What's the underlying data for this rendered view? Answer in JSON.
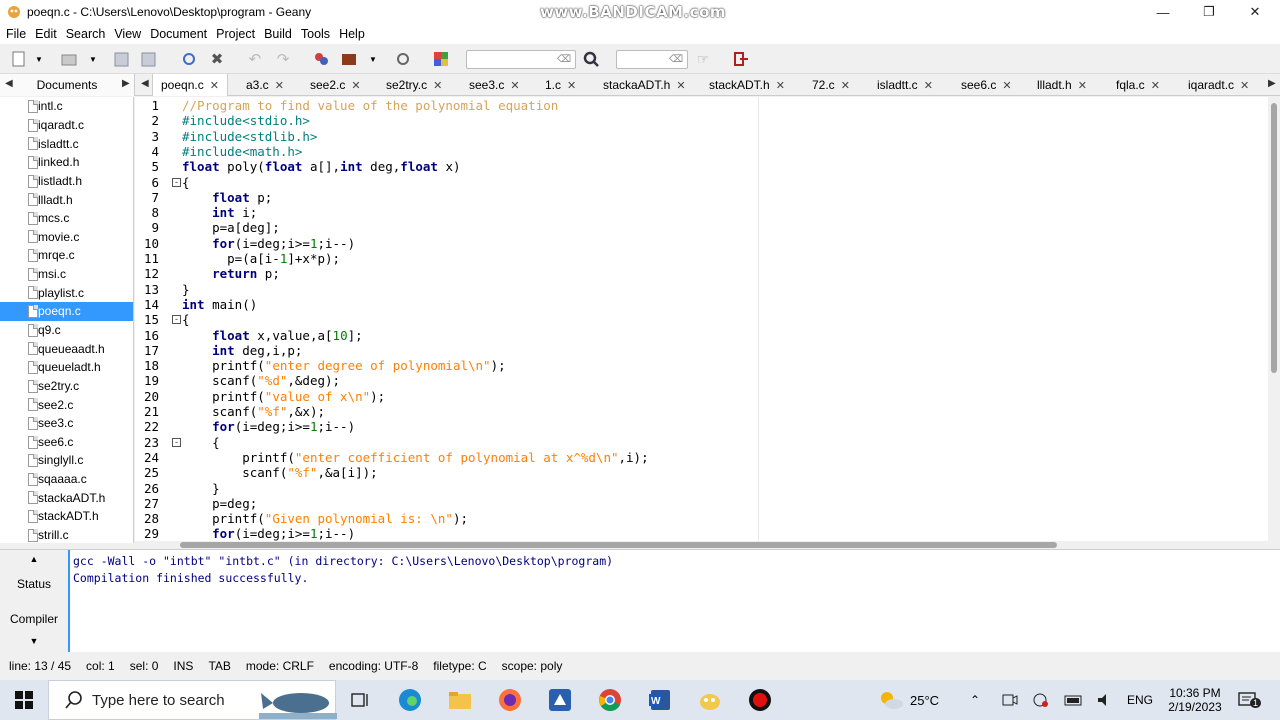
{
  "window": {
    "title": "poeqn.c - C:\\Users\\Lenovo\\Desktop\\program - Geany",
    "watermark": "www.BANDICAM.com"
  },
  "menu": [
    "File",
    "Edit",
    "Search",
    "View",
    "Document",
    "Project",
    "Build",
    "Tools",
    "Help"
  ],
  "toolbar": {
    "search_placeholder": "",
    "goto_placeholder": ""
  },
  "sidebar": {
    "tab_label": "Documents",
    "files": [
      "intl.c",
      "iqaradt.c",
      "isladtt.c",
      "linked.h",
      "listladt.h",
      "llladt.h",
      "mcs.c",
      "movie.c",
      "mrqe.c",
      "msi.c",
      "playlist.c",
      "poeqn.c",
      "q9.c",
      "queueaadt.h",
      "queueladt.h",
      "se2try.c",
      "see2.c",
      "see3.c",
      "see6.c",
      "singlyll.c",
      "sqaaaa.c",
      "stackaADT.h",
      "stackADT.h",
      "strill.c"
    ],
    "selected_index": 11
  },
  "tabs": [
    "poeqn.c",
    "a3.c",
    "see2.c",
    "se2try.c",
    "see3.c",
    "1.c",
    "stackaADT.h",
    "stackADT.h",
    "72.c",
    "isladtt.c",
    "see6.c",
    "llladt.h",
    "fqla.c",
    "iqaradt.c"
  ],
  "editor": {
    "lines": [
      {
        "n": "1",
        "code": "//Program to find value of the polynomial equation"
      },
      {
        "n": "2",
        "code": "#include<stdio.h>"
      },
      {
        "n": "3",
        "code": "#include<stdlib.h>"
      },
      {
        "n": "4",
        "code": "#include<math.h>"
      },
      {
        "n": "5",
        "code": "float poly(float a[],int deg,float x)"
      },
      {
        "n": "6",
        "code": "{"
      },
      {
        "n": "7",
        "code": "    float p;"
      },
      {
        "n": "8",
        "code": "    int i;"
      },
      {
        "n": "9",
        "code": "    p=a[deg];"
      },
      {
        "n": "10",
        "code": "    for(i=deg;i>=1;i--)"
      },
      {
        "n": "11",
        "code": "      p=(a[i-1]+x*p);"
      },
      {
        "n": "12",
        "code": "    return p;"
      },
      {
        "n": "13",
        "code": "}"
      },
      {
        "n": "14",
        "code": "int main()"
      },
      {
        "n": "15",
        "code": "{"
      },
      {
        "n": "16",
        "code": "    float x,value,a[10];"
      },
      {
        "n": "17",
        "code": "    int deg,i,p;"
      },
      {
        "n": "18",
        "code": "    printf(\"enter degree of polynomial\\n\");"
      },
      {
        "n": "19",
        "code": "    scanf(\"%d\",&deg);"
      },
      {
        "n": "20",
        "code": "    printf(\"value of x\\n\");"
      },
      {
        "n": "21",
        "code": "    scanf(\"%f\",&x);"
      },
      {
        "n": "22",
        "code": "    for(i=deg;i>=1;i--)"
      },
      {
        "n": "23",
        "code": "    {"
      },
      {
        "n": "24",
        "code": "        printf(\"enter coefficient of polynomial at x^%d\\n\",i);"
      },
      {
        "n": "25",
        "code": "        scanf(\"%f\",&a[i]);"
      },
      {
        "n": "26",
        "code": "    }"
      },
      {
        "n": "27",
        "code": "    p=deg;"
      },
      {
        "n": "28",
        "code": "    printf(\"Given polynomial is: \\n\");"
      },
      {
        "n": "29",
        "code": "    for(i=deg;i>=1;i--)"
      }
    ]
  },
  "messages": {
    "status_label": "Status",
    "compiler_label": "Compiler",
    "lines": [
      "gcc -Wall -o \"intbt\" \"intbt.c\" (in directory: C:\\Users\\Lenovo\\Desktop\\program)",
      "Compilation finished successfully."
    ]
  },
  "statusbar": {
    "line": "line: 13 / 45",
    "col": "col: 1",
    "sel": "sel: 0",
    "ins": "INS",
    "tab": "TAB",
    "mode": "mode: CRLF",
    "encoding": "encoding: UTF-8",
    "filetype": "filetype: C",
    "scope": "scope: poly"
  },
  "taskbar": {
    "search_placeholder": "Type here to search",
    "temperature": "25°C",
    "language": "ENG",
    "time": "10:36 PM",
    "date": "2/19/2023",
    "notification_count": "1"
  },
  "colors": {
    "accent": "#3399ff",
    "keyword": "#00007f",
    "comment": "#d6a45a",
    "preproc": "#007f7f",
    "string": "#ff8000",
    "number": "#007f00"
  }
}
